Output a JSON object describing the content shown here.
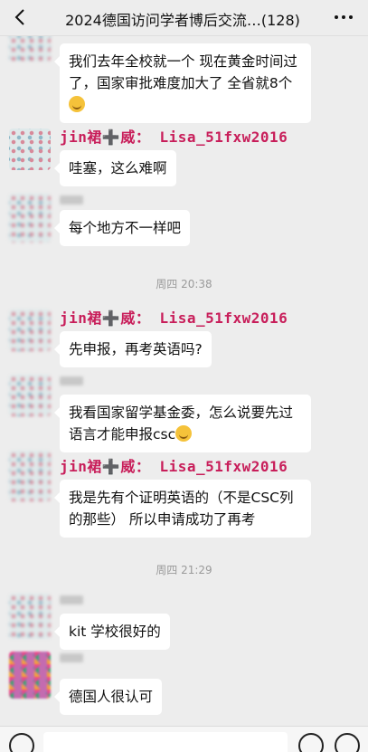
{
  "header": {
    "title": "2024德国访问学者博后交流…(128)",
    "back_icon": "chevron-left-icon",
    "more_icon": "more-dots-icon"
  },
  "sender_tag": "jin裙➕威： Lisa_51fxw2016",
  "messages": [
    {
      "id": "m1",
      "text": "我们去年全校就一个 现在黄金时间过了，国家审批难度加大了 全省就8个"
    },
    {
      "id": "m2",
      "text": "哇塞，这么难啊"
    },
    {
      "id": "m3",
      "text": "每个地方不一样吧"
    },
    {
      "id": "m4",
      "text": "先申报，再考英语吗?"
    },
    {
      "id": "m5",
      "text": "我看国家留学基金委，怎么说要先过语言才能申报csc"
    },
    {
      "id": "m6",
      "text": "我是先有个证明英语的（不是CSC列的那些） 所以申请成功了再考"
    },
    {
      "id": "m7",
      "text": "kit 学校很好的"
    },
    {
      "id": "m8",
      "text": "德国人很认可"
    }
  ],
  "timestamps": [
    "周四 20:38",
    "周四 21:29"
  ],
  "bottom": {
    "voice_icon": "voice-icon",
    "emoji_icon": "emoji-face-icon",
    "plus_icon": "plus-icon"
  },
  "colors": {
    "sender_name": "#c81e5a",
    "bubble": "#ffffff",
    "background": "#ededed"
  }
}
